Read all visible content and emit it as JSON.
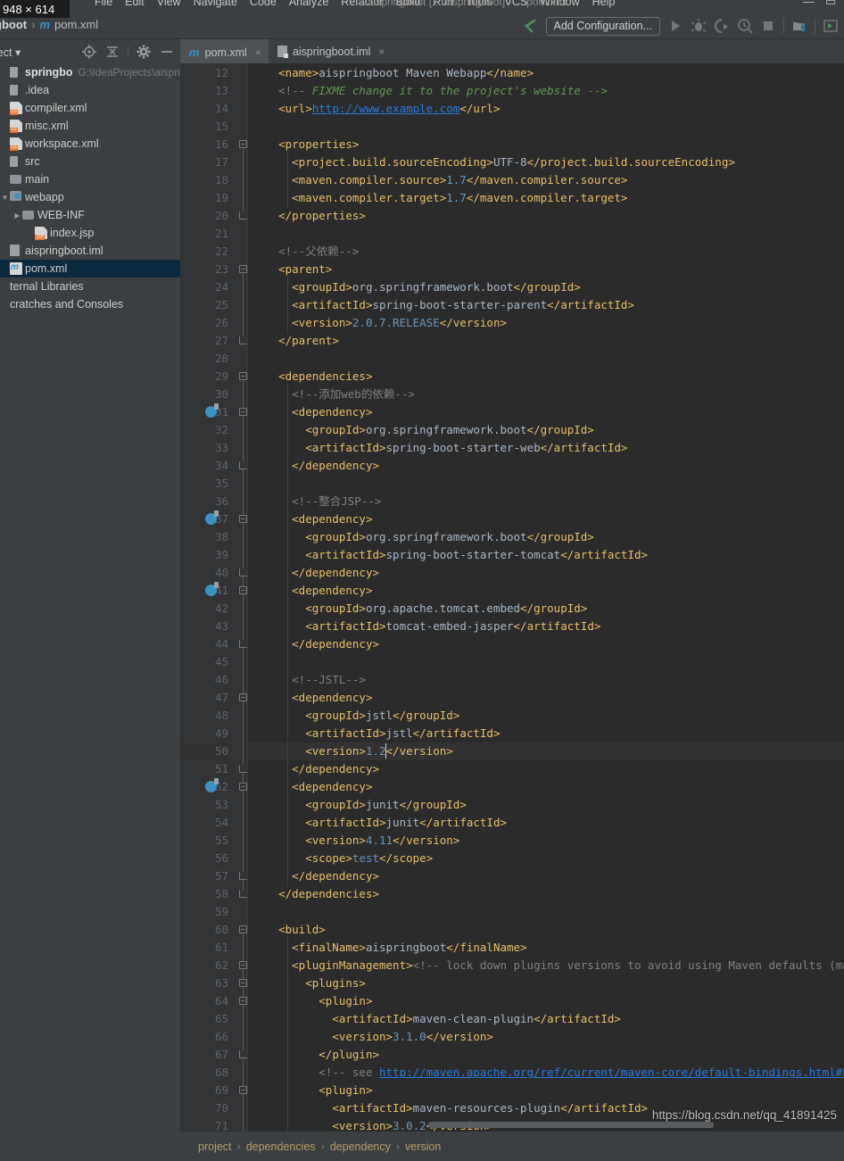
{
  "window": {
    "size_badge": "948 × 614",
    "title": "aispringboot [...\\aispringboot] - ...\\pom.xml",
    "menu": [
      "File",
      "Edit",
      "View",
      "Navigate",
      "Code",
      "Analyze",
      "Refactor",
      "Build",
      "Run",
      "Tools",
      "VCS",
      "Window",
      "Help"
    ],
    "minimize": "—",
    "maximize": "▭"
  },
  "navbar": {
    "project_crumb": "gboot",
    "separator": "›",
    "file_icon_letter": "m",
    "file_crumb": "pom.xml",
    "add_configuration": "Add Configuration...",
    "icons": [
      "back-arrow-icon",
      "run-icon",
      "debug-icon",
      "run-with-coverage-icon",
      "profile-icon",
      "stop-icon",
      "project-structure-icon",
      "run-anything-icon"
    ]
  },
  "tool_window": {
    "title": "ject",
    "dropdown": "▾",
    "icons": [
      "locate-icon",
      "collapse-all-icon",
      "settings-gear-icon",
      "hide-icon"
    ]
  },
  "project_tree": [
    {
      "depth": 0,
      "arrow": "",
      "icon": "module-icon",
      "label": "springboot",
      "path": "G:\\IdeaProjects\\aispri",
      "bold": true,
      "selected": false
    },
    {
      "depth": 0,
      "arrow": "",
      "icon": "module-icon",
      "label": ".idea",
      "path": "",
      "bold": false,
      "selected": false
    },
    {
      "depth": 1,
      "arrow": "",
      "icon": "xml-icon",
      "label": "compiler.xml",
      "path": "",
      "bold": false,
      "selected": false
    },
    {
      "depth": 1,
      "arrow": "",
      "icon": "xml-icon",
      "label": "misc.xml",
      "path": "",
      "bold": false,
      "selected": false
    },
    {
      "depth": 1,
      "arrow": "",
      "icon": "xml-icon",
      "label": "workspace.xml",
      "path": "",
      "bold": false,
      "selected": false
    },
    {
      "depth": 0,
      "arrow": "",
      "icon": "module-icon",
      "label": "src",
      "path": "",
      "bold": false,
      "selected": false
    },
    {
      "depth": 1,
      "arrow": "",
      "icon": "folder-icon",
      "label": "main",
      "path": "",
      "bold": false,
      "selected": false
    },
    {
      "depth": 1,
      "arrow": "▼",
      "icon": "webapp-icon",
      "label": "webapp",
      "path": "",
      "bold": false,
      "selected": false
    },
    {
      "depth": 2,
      "arrow": "▶",
      "icon": "folder-icon",
      "label": "WEB-INF",
      "path": "",
      "bold": false,
      "selected": false
    },
    {
      "depth": 3,
      "arrow": "",
      "icon": "jsp-icon",
      "label": "index.jsp",
      "path": "",
      "bold": false,
      "selected": false
    },
    {
      "depth": 0,
      "arrow": "",
      "icon": "iml-icon",
      "label": "aispringboot.iml",
      "path": "",
      "bold": false,
      "selected": false
    },
    {
      "depth": 0,
      "arrow": "",
      "icon": "pom-icon",
      "label": "pom.xml",
      "path": "",
      "bold": false,
      "selected": true
    },
    {
      "depth": 0,
      "arrow": "",
      "icon": "",
      "label": "ternal Libraries",
      "path": "",
      "bold": false,
      "selected": false
    },
    {
      "depth": 0,
      "arrow": "",
      "icon": "",
      "label": "cratches and Consoles",
      "path": "",
      "bold": false,
      "selected": false
    }
  ],
  "tabs": [
    {
      "label": "pom.xml",
      "icon": "maven-m-icon",
      "active": true,
      "close": "×"
    },
    {
      "label": "aispringboot.iml",
      "icon": "iml-icon",
      "active": false,
      "close": "×"
    }
  ],
  "editor": {
    "first_line": 12,
    "highlighted_line": 50,
    "selection_text": "<version>1.2</version>",
    "lines": [
      {
        "n": 12,
        "text": "    <name>aispringboot Maven Webapp</name>"
      },
      {
        "n": 13,
        "text": "    <!-- FIXME change it to the project's website -->"
      },
      {
        "n": 14,
        "text": "    <url>http://www.example.com</url>"
      },
      {
        "n": 15,
        "text": ""
      },
      {
        "n": 16,
        "text": "    <properties>"
      },
      {
        "n": 17,
        "text": "      <project.build.sourceEncoding>UTF-8</project.build.sourceEncoding>"
      },
      {
        "n": 18,
        "text": "      <maven.compiler.source>1.7</maven.compiler.source>"
      },
      {
        "n": 19,
        "text": "      <maven.compiler.target>1.7</maven.compiler.target>"
      },
      {
        "n": 20,
        "text": "    </properties>"
      },
      {
        "n": 21,
        "text": ""
      },
      {
        "n": 22,
        "text": "    <!--父依赖-->"
      },
      {
        "n": 23,
        "text": "    <parent>"
      },
      {
        "n": 24,
        "text": "      <groupId>org.springframework.boot</groupId>"
      },
      {
        "n": 25,
        "text": "      <artifactId>spring-boot-starter-parent</artifactId>"
      },
      {
        "n": 26,
        "text": "      <version>2.0.7.RELEASE</version>"
      },
      {
        "n": 27,
        "text": "    </parent>"
      },
      {
        "n": 28,
        "text": ""
      },
      {
        "n": 29,
        "text": "    <dependencies>"
      },
      {
        "n": 30,
        "text": "      <!--添加web的依赖-->"
      },
      {
        "n": 31,
        "text": "      <dependency>"
      },
      {
        "n": 32,
        "text": "        <groupId>org.springframework.boot</groupId>"
      },
      {
        "n": 33,
        "text": "        <artifactId>spring-boot-starter-web</artifactId>"
      },
      {
        "n": 34,
        "text": "      </dependency>"
      },
      {
        "n": 35,
        "text": ""
      },
      {
        "n": 36,
        "text": "      <!--整合JSP-->"
      },
      {
        "n": 37,
        "text": "      <dependency>"
      },
      {
        "n": 38,
        "text": "        <groupId>org.springframework.boot</groupId>"
      },
      {
        "n": 39,
        "text": "        <artifactId>spring-boot-starter-tomcat</artifactId>"
      },
      {
        "n": 40,
        "text": "      </dependency>"
      },
      {
        "n": 41,
        "text": "      <dependency>"
      },
      {
        "n": 42,
        "text": "        <groupId>org.apache.tomcat.embed</groupId>"
      },
      {
        "n": 43,
        "text": "        <artifactId>tomcat-embed-jasper</artifactId>"
      },
      {
        "n": 44,
        "text": "      </dependency>"
      },
      {
        "n": 45,
        "text": ""
      },
      {
        "n": 46,
        "text": "      <!--JSTL-->"
      },
      {
        "n": 47,
        "text": "      <dependency>"
      },
      {
        "n": 48,
        "text": "        <groupId>jstl</groupId>"
      },
      {
        "n": 49,
        "text": "        <artifactId>jstl</artifactId>"
      },
      {
        "n": 50,
        "text": "        <version>1.2</version>"
      },
      {
        "n": 51,
        "text": "      </dependency>"
      },
      {
        "n": 52,
        "text": "      <dependency>"
      },
      {
        "n": 53,
        "text": "        <groupId>junit</groupId>"
      },
      {
        "n": 54,
        "text": "        <artifactId>junit</artifactId>"
      },
      {
        "n": 55,
        "text": "        <version>4.11</version>"
      },
      {
        "n": 56,
        "text": "        <scope>test</scope>"
      },
      {
        "n": 57,
        "text": "      </dependency>"
      },
      {
        "n": 58,
        "text": "    </dependencies>"
      },
      {
        "n": 59,
        "text": ""
      },
      {
        "n": 60,
        "text": "    <build>"
      },
      {
        "n": 61,
        "text": "      <finalName>aispringboot</finalName>"
      },
      {
        "n": 62,
        "text": "      <pluginManagement><!-- lock down plugins versions to avoid using Maven defaults (may be moved"
      },
      {
        "n": 63,
        "text": "        <plugins>"
      },
      {
        "n": 64,
        "text": "          <plugin>"
      },
      {
        "n": 65,
        "text": "            <artifactId>maven-clean-plugin</artifactId>"
      },
      {
        "n": 66,
        "text": "            <version>3.1.0</version>"
      },
      {
        "n": 67,
        "text": "          </plugin>"
      },
      {
        "n": 68,
        "text": "          <!-- see http://maven.apache.org/ref/current/maven-core/default-bindings.html#Plugin_bind"
      },
      {
        "n": 69,
        "text": "          <plugin>"
      },
      {
        "n": 70,
        "text": "            <artifactId>maven-resources-plugin</artifactId>"
      },
      {
        "n": 71,
        "text": "            <version>3.0.2</version>"
      },
      {
        "n": 72,
        "text": "          </plugin>"
      }
    ],
    "maven_gutter_lines": [
      31,
      37,
      41,
      52
    ]
  },
  "watermark": "https://blog.csdn.net/qq_41891425",
  "bottom_breadcrumb": [
    "project",
    "dependencies",
    "dependency",
    "version"
  ],
  "bottom_separator": "›",
  "colors": {
    "editor_bg": "#2b2b2b",
    "gutter_bg": "#313335",
    "panel_bg": "#3c3f41",
    "tab_active_bg": "#4e5254",
    "tree_selection": "#0d293e",
    "tag": "#e8bf6a",
    "text": "#a9b7c6",
    "comment": "#808080",
    "doc_comment": "#629755",
    "number": "#6897bb",
    "link": "#287bde",
    "selection": "#3a5f5b",
    "accent_blue": "#3592c4",
    "run_green": "#59a869"
  }
}
